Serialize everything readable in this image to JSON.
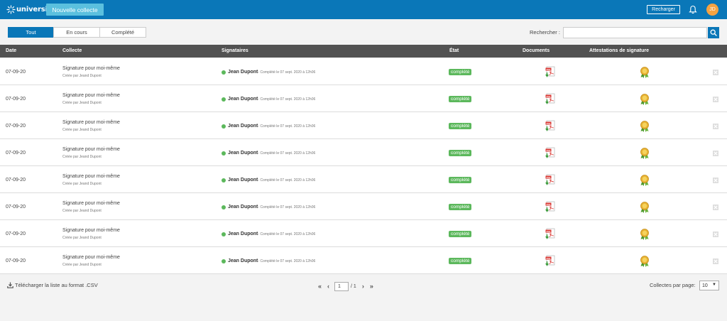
{
  "header": {
    "logo_text": "universign",
    "new_button": "Nouvelle collecte",
    "reload_button": "Recharger",
    "avatar_initials": "JD"
  },
  "filters": {
    "tabs": [
      {
        "label": "Tout",
        "active": true
      },
      {
        "label": "En cours",
        "active": false
      },
      {
        "label": "Complété",
        "active": false
      }
    ],
    "search_label": "Rechercher :",
    "search_value": ""
  },
  "table": {
    "columns": {
      "date": "Date",
      "collecte": "Collecte",
      "signataires": "Signataires",
      "etat": "État",
      "documents": "Documents",
      "attestations": "Attestations de signature"
    },
    "rows": [
      {
        "date": "07-09-20",
        "title": "Signature pour moi-même",
        "subtitle": "Créée par Jeand Dupont",
        "signer": "Jean Dupont",
        "signer_detail": "- Complété le 07 sept. 2020 à 12h06",
        "status": "complété"
      },
      {
        "date": "07-09-20",
        "title": "Signature pour moi-même",
        "subtitle": "Créée par Jeand Dupont",
        "signer": "Jean Dupont",
        "signer_detail": "- Complété le 07 sept. 2020 à 12h06",
        "status": "complété"
      },
      {
        "date": "07-09-20",
        "title": "Signature pour moi-même",
        "subtitle": "Créée par Jeand Dupont",
        "signer": "Jean Dupont",
        "signer_detail": "- Complété le 07 sept. 2020 à 12h06",
        "status": "complété"
      },
      {
        "date": "07-09-20",
        "title": "Signature pour moi-même",
        "subtitle": "Créée par Jeand Dupont",
        "signer": "Jean Dupont",
        "signer_detail": "- Complété le 07 sept. 2020 à 12h06",
        "status": "complété"
      },
      {
        "date": "07-09-20",
        "title": "Signature pour moi-même",
        "subtitle": "Créée par Jeand Dupont",
        "signer": "Jean Dupont",
        "signer_detail": "- Complété le 07 sept. 2020 à 12h06",
        "status": "complété"
      },
      {
        "date": "07-09-20",
        "title": "Signature pour moi-même",
        "subtitle": "Créée par Jeand Dupont",
        "signer": "Jean Dupont",
        "signer_detail": "- Complété le 07 sept. 2020 à 12h06",
        "status": "complété"
      },
      {
        "date": "07-09-20",
        "title": "Signature pour moi-même",
        "subtitle": "Créée par Jeand Dupont",
        "signer": "Jean Dupont",
        "signer_detail": "- Complété le 07 sept. 2020 à 12h06",
        "status": "complété"
      },
      {
        "date": "07-09-20",
        "title": "Signature pour moi-même",
        "subtitle": "Créée par Jeand Dupont",
        "signer": "Jean Dupont",
        "signer_detail": "- Complété le 07 sept. 2020 à 12h06",
        "status": "complété"
      }
    ]
  },
  "footer": {
    "download_label": "Télécharger la liste au format .CSV",
    "page_current": "1",
    "page_total": "/ 1",
    "per_page_label": "Collectes par page:",
    "per_page_value": "10"
  },
  "colors": {
    "brand": "#0a77b8",
    "accent": "#5bc0de",
    "success": "#5cb85c",
    "avatar": "#f5a342"
  },
  "icons": [
    "logo-star-icon",
    "bell-icon",
    "search-icon",
    "pdf-download-icon",
    "medal-icon",
    "delete-icon",
    "download-icon",
    "first-page-icon",
    "prev-page-icon",
    "next-page-icon",
    "last-page-icon",
    "caret-down-icon"
  ]
}
